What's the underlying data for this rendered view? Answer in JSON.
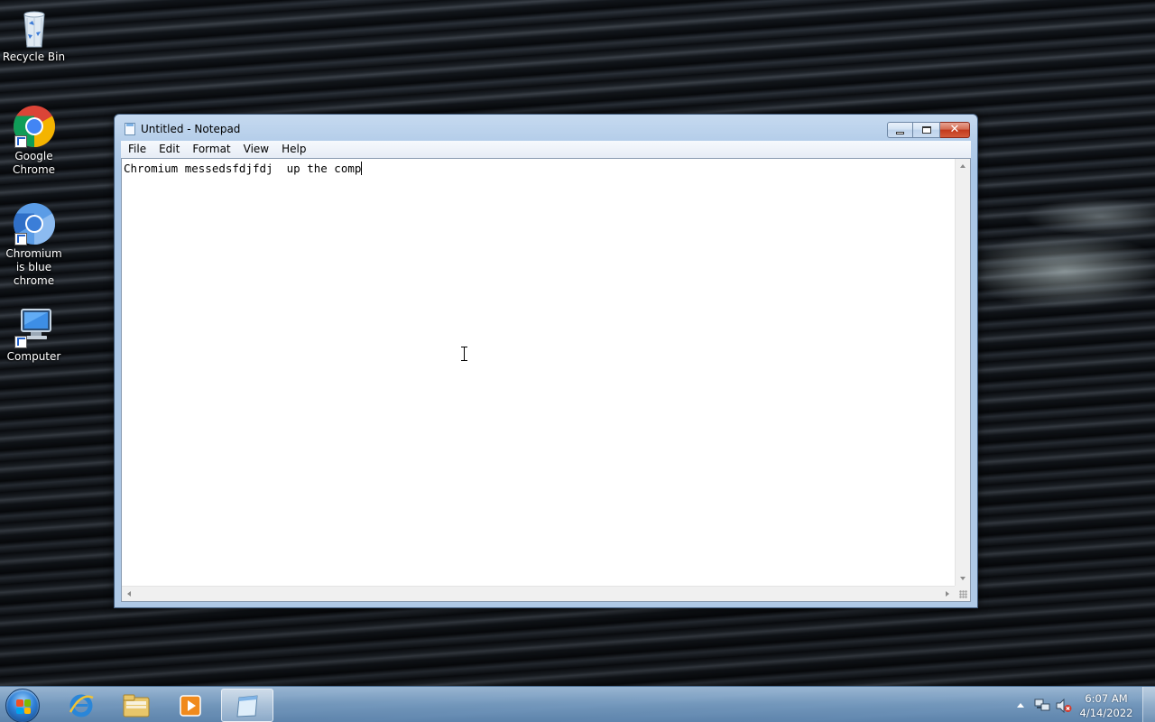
{
  "desktop": {
    "icons": [
      {
        "label": "Recycle Bin"
      },
      {
        "label": "Google Chrome"
      },
      {
        "label": "Chromium is blue chrome"
      },
      {
        "label": "Computer"
      }
    ]
  },
  "notepad": {
    "title": "Untitled - Notepad",
    "menu": [
      "File",
      "Edit",
      "Format",
      "View",
      "Help"
    ],
    "content": "Chromium messedsfdjfdj  up the comp"
  },
  "taskbar": {
    "apps": [
      "start-icon",
      "internet-explorer-icon",
      "explorer-icon",
      "media-player-icon",
      "notepad-icon"
    ],
    "clock_time": "6:07 AM",
    "clock_date": "4/14/2022"
  }
}
